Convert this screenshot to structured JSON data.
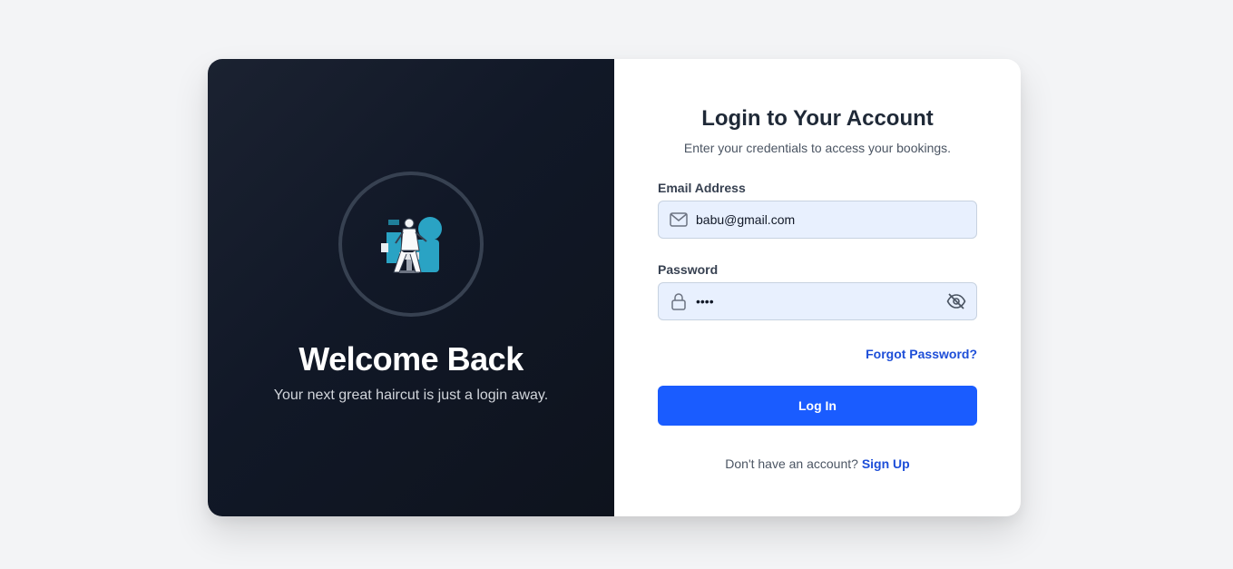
{
  "colors": {
    "page_bg": "#f3f4f6",
    "left_panel_bg": "#111827",
    "accent": "#1a5cff",
    "link": "#1d4ed8",
    "input_bg": "#e8f0fe"
  },
  "left_panel": {
    "logo_icon": "barber-chair-illustration",
    "heading": "Welcome Back",
    "tagline": "Your next great haircut is just a login away."
  },
  "form": {
    "title": "Login to Your Account",
    "subtitle": "Enter your credentials to access your bookings.",
    "email": {
      "label": "Email Address",
      "value": "babu@gmail.com",
      "icon": "mail-icon"
    },
    "password": {
      "label": "Password",
      "value": "••••",
      "icon": "lock-icon",
      "toggle_icon": "eye-off-icon"
    },
    "forgot_link": "Forgot Password?",
    "submit_label": "Log In",
    "signup_prompt": "Don't have an account?",
    "signup_link": "Sign Up"
  }
}
